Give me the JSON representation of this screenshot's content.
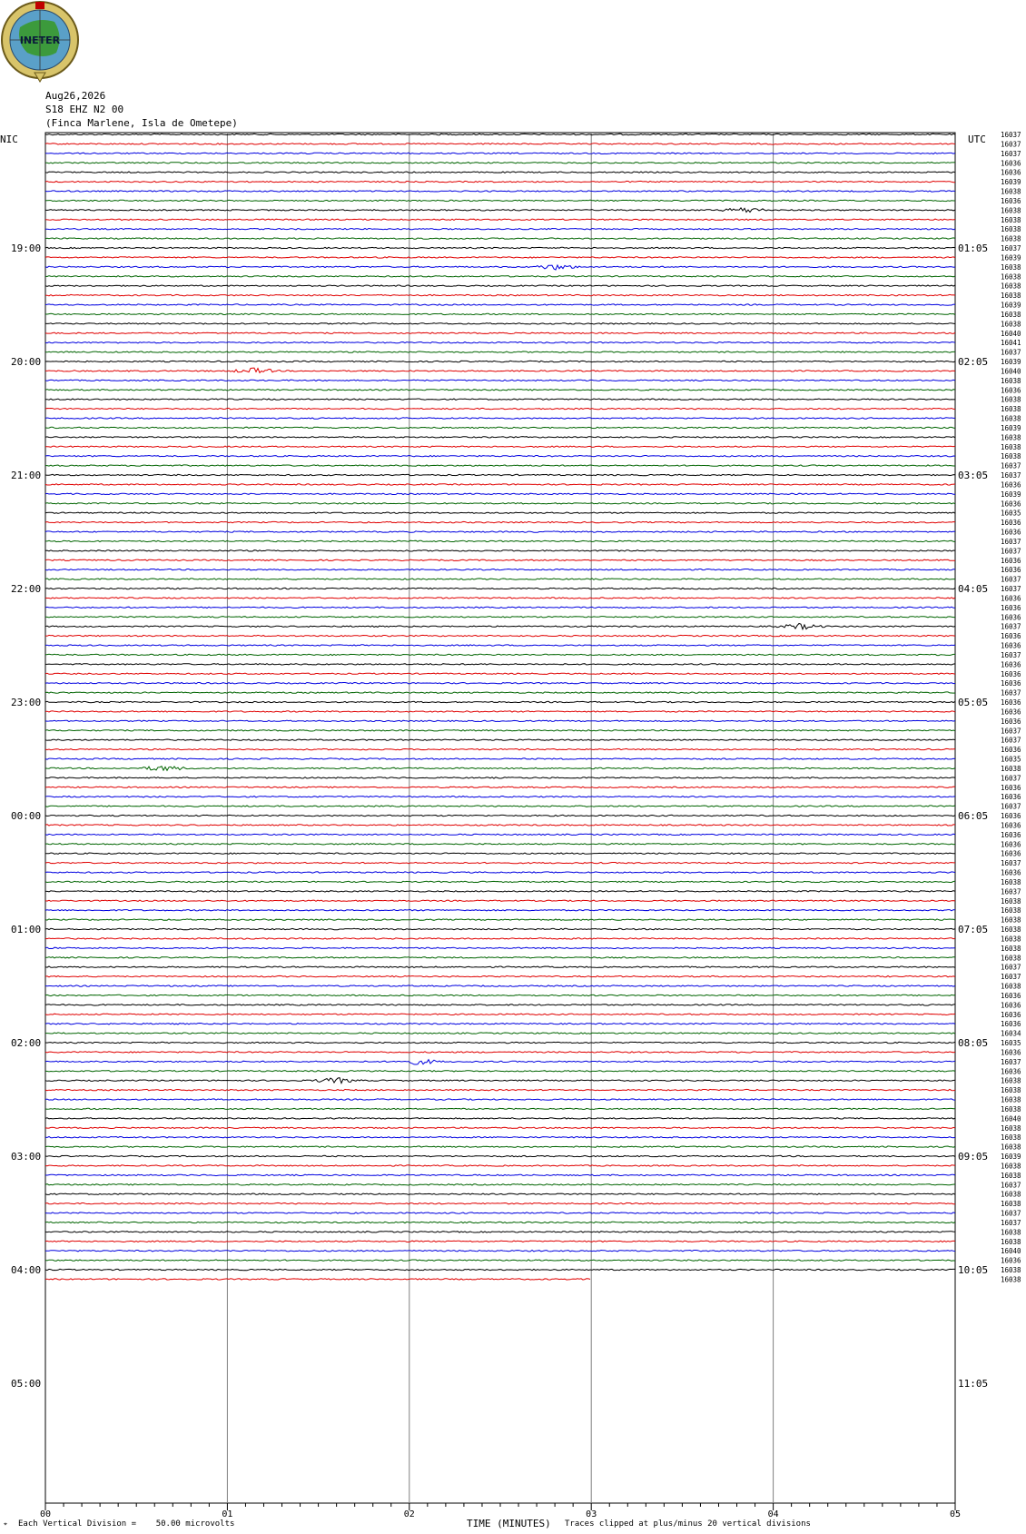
{
  "header": {
    "logo_text": "INETER",
    "date": "Aug26,2026",
    "channel": "S18 EHZ N2 00",
    "location": "(Finca Marlene, Isla de Ometepe)"
  },
  "footer": {
    "scale_note": "Each Vertical Division =    50.00 microvolts",
    "xaxis_title": "TIME (MINUTES)",
    "clip_note": "Traces clipped at plus/minus 20 vertical divisions"
  },
  "colors": {
    "trace_cycle": [
      "#000000",
      "#e00000",
      "#0000e0",
      "#006400"
    ],
    "grid": "#808080"
  },
  "chart_data": {
    "type": "line",
    "title": "",
    "left_axis_title": "NIC",
    "right_axis_title": "UTC",
    "xlabel": "TIME (MINUTES)",
    "x_ticks": [
      "00",
      "01",
      "02",
      "03",
      "04",
      "05"
    ],
    "xlim": [
      0,
      5
    ],
    "left_hour_labels": [
      "19:00",
      "20:00",
      "21:00",
      "22:00",
      "23:00",
      "00:00",
      "01:00",
      "02:00",
      "03:00",
      "04:00",
      "05:00"
    ],
    "right_hour_labels": [
      "01:05",
      "02:05",
      "03:05",
      "04:05",
      "05:05",
      "06:05",
      "07:05",
      "08:05",
      "09:05",
      "10:05",
      "11:05"
    ],
    "trace_count": 122,
    "last_trace_end_minute": 3,
    "trace_values": [
      "16037",
      "16037",
      "16037",
      "16036",
      "16036",
      "16039",
      "16038",
      "16036",
      "16038",
      "16038",
      "16038",
      "16038",
      "16037",
      "16039",
      "16038",
      "16038",
      "16038",
      "16038",
      "16039",
      "16038",
      "16038",
      "16040",
      "16041",
      "16037",
      "16039",
      "16040",
      "16038",
      "16036",
      "16038",
      "16038",
      "16038",
      "16039",
      "16038",
      "16038",
      "16038",
      "16037",
      "16037",
      "16036",
      "16039",
      "16036",
      "16035",
      "16036",
      "16036",
      "16037",
      "16037",
      "16036",
      "16036",
      "16037",
      "16037",
      "16036",
      "16036",
      "16036",
      "16037",
      "16036",
      "16036",
      "16037",
      "16036",
      "16036",
      "16036",
      "16037",
      "16036",
      "16036",
      "16036",
      "16037",
      "16037",
      "16036",
      "16035",
      "16038",
      "16037",
      "16036",
      "16036",
      "16037",
      "16036",
      "16036",
      "16036",
      "16036",
      "16036",
      "16037",
      "16036",
      "16038",
      "16037",
      "16038",
      "16038",
      "16038",
      "16038",
      "16038",
      "16038",
      "16038",
      "16037",
      "16037",
      "16038",
      "16036",
      "16036",
      "16036",
      "16036",
      "16034",
      "16035",
      "16036",
      "16037",
      "16036",
      "16038",
      "16038",
      "16038",
      "16038",
      "16040",
      "16038",
      "16038",
      "16038",
      "16039",
      "16038",
      "16038",
      "16037",
      "16038",
      "16038",
      "16037",
      "16037",
      "16038",
      "16038",
      "16040",
      "16036",
      "16038",
      "16038",
      "16037"
    ],
    "notable_events": [
      {
        "trace": 8,
        "minute": 3.85
      },
      {
        "trace": 14,
        "minute": 2.8
      },
      {
        "trace": 25,
        "minute": 1.15
      },
      {
        "trace": 52,
        "minute": 4.15
      },
      {
        "trace": 67,
        "minute": 0.65
      },
      {
        "trace": 98,
        "minute": 2.05
      },
      {
        "trace": 100,
        "minute": 1.6
      }
    ]
  }
}
